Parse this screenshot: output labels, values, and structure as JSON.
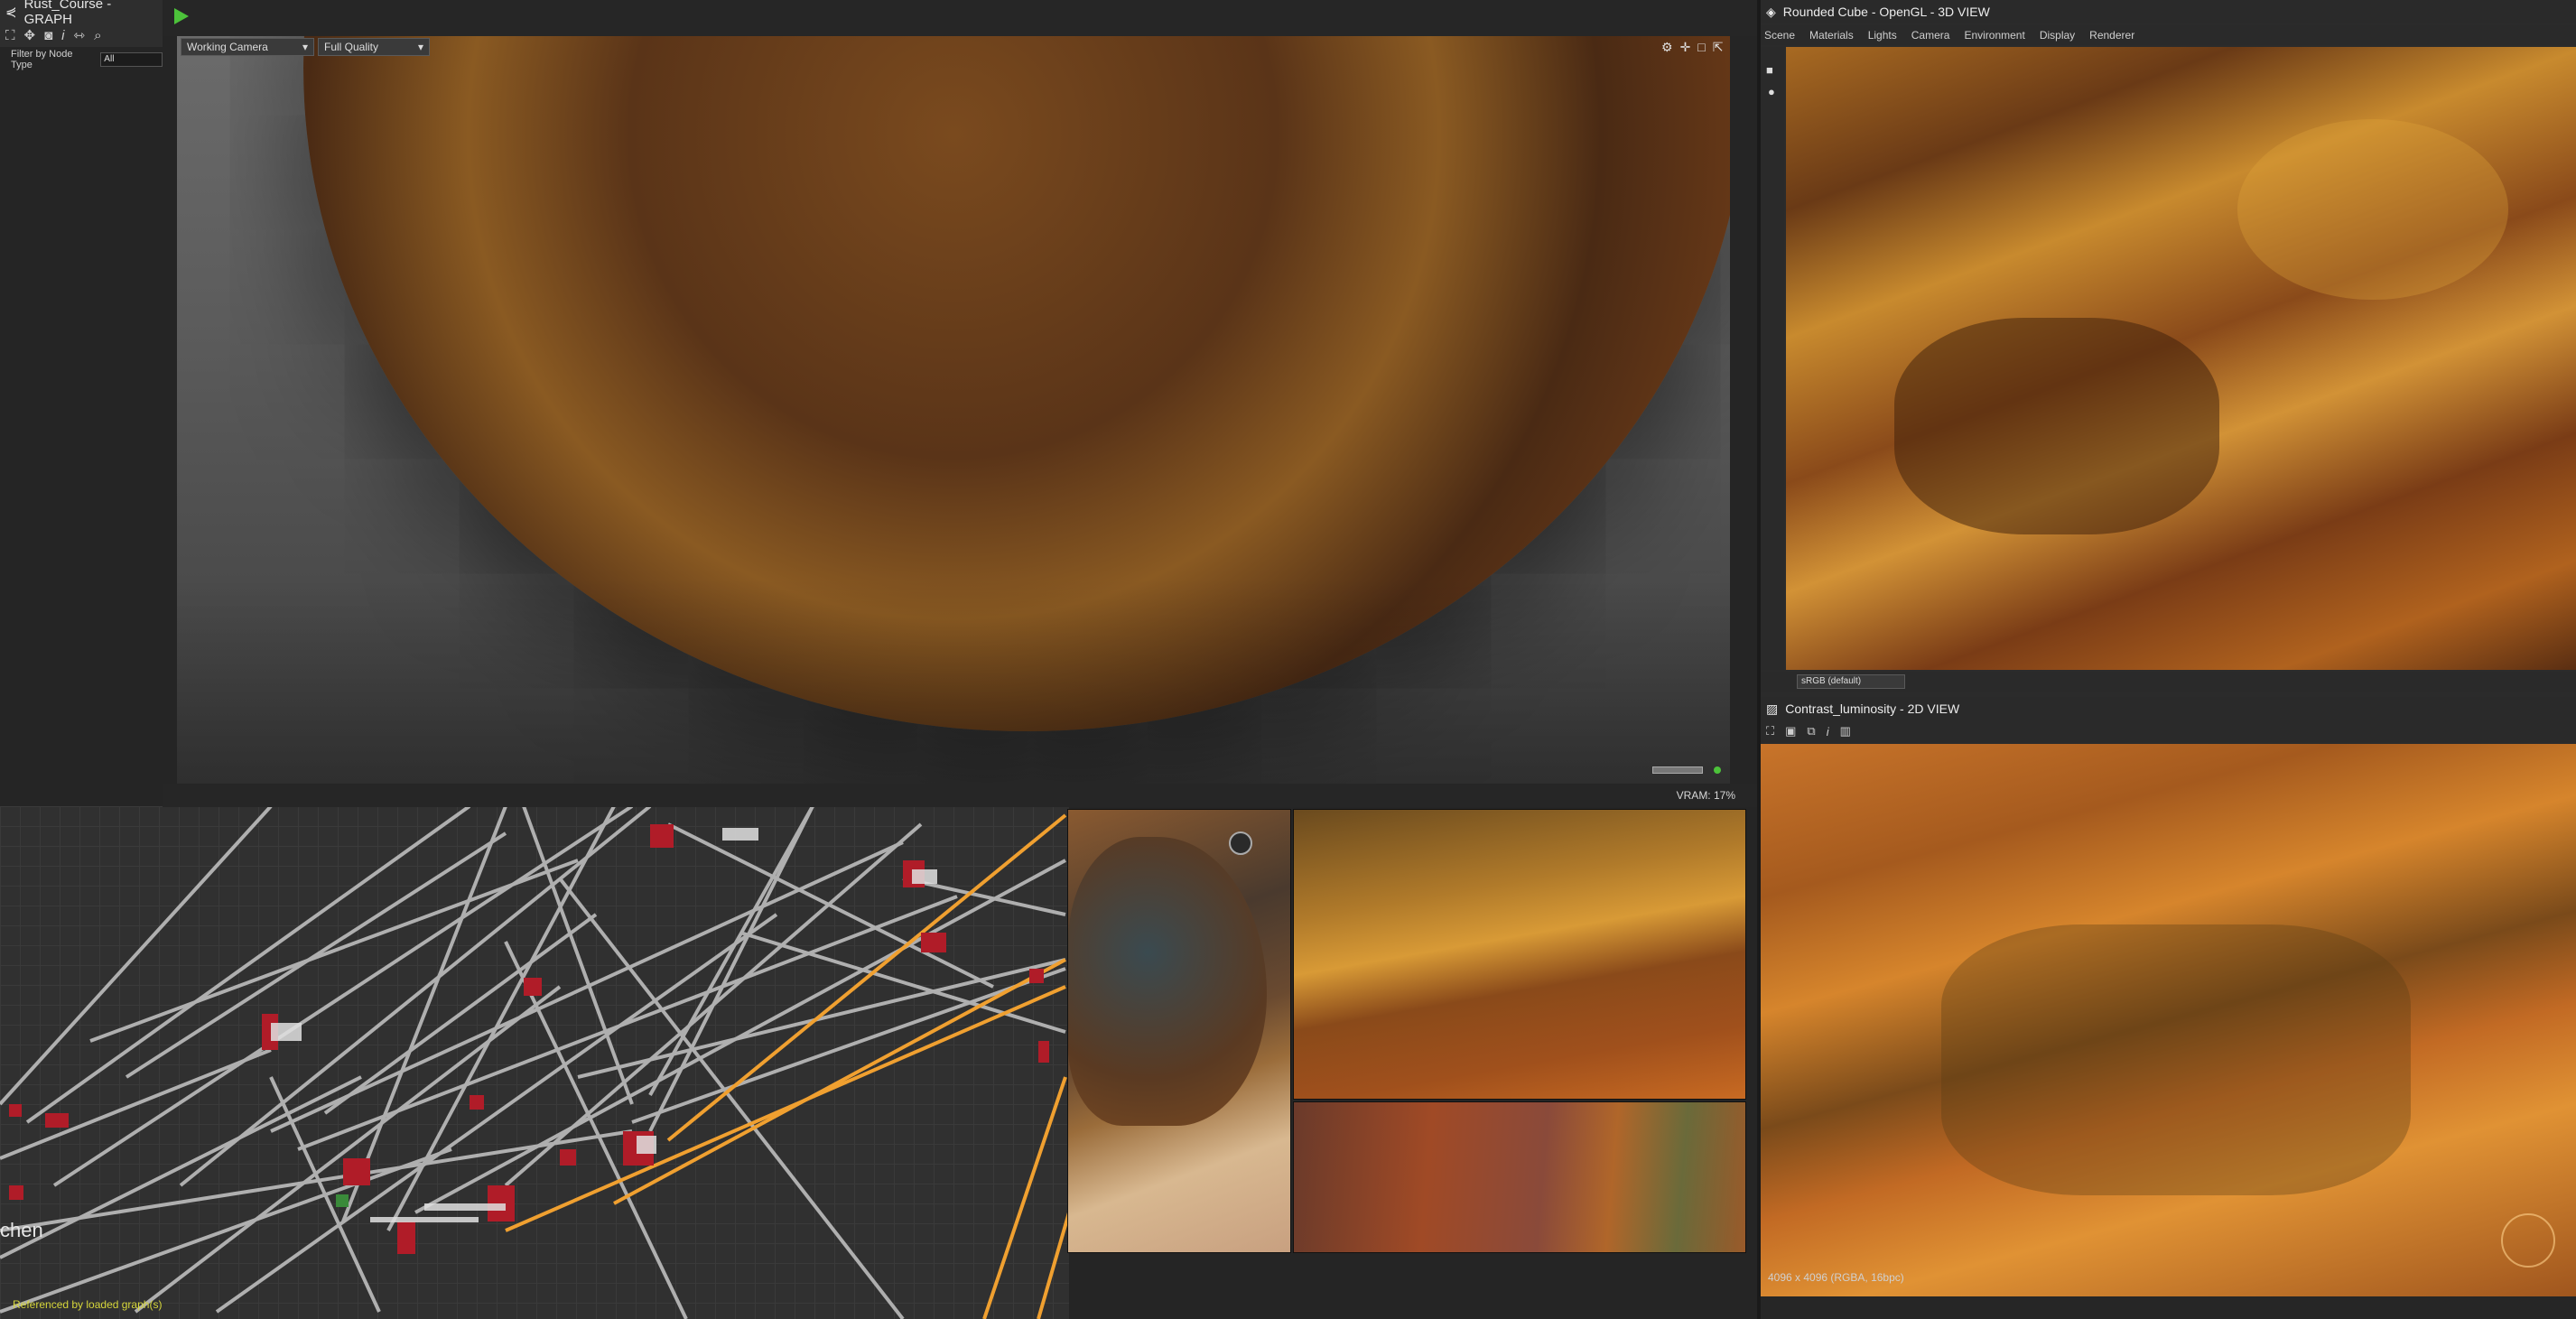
{
  "graph": {
    "title": "Rust_Course - GRAPH",
    "filter_label": "Filter by Node Type",
    "filter_value": "All",
    "footer": "Referenced by loaded graph(s)",
    "frame_label": "chen"
  },
  "viewport": {
    "camera": "Working Camera",
    "quality": "Full Quality",
    "vram": "VRAM: 17%"
  },
  "view3d": {
    "title": "Rounded Cube - OpenGL - 3D VIEW",
    "menu": [
      "Scene",
      "Materials",
      "Lights",
      "Camera",
      "Environment",
      "Display",
      "Renderer"
    ],
    "colorspace": "sRGB (default)"
  },
  "view2d": {
    "title": "Contrast_luminosity - 2D VIEW",
    "image_info": "4096 x 4096 (RGBA, 16bpc)"
  },
  "colors": {
    "panel_bg": "#2a2a2a",
    "graph_bg": "#303030",
    "wire": "#bdbdbd",
    "wire_accent": "#f0a030",
    "node_red": "#b01c28",
    "play_green": "#4cc23a"
  },
  "icons": [
    "graph-icon",
    "fit-icon",
    "pan-icon",
    "camera-icon",
    "info-icon",
    "link-icon",
    "search-icon",
    "play-icon",
    "settings-icon",
    "crosshair-icon",
    "square-icon",
    "popout-icon",
    "cube-icon",
    "camera-side-icon",
    "light-icon",
    "save-icon",
    "copy-icon",
    "histogram-icon"
  ]
}
